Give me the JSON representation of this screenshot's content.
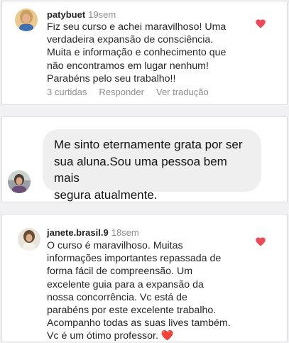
{
  "comments": [
    {
      "username": "patybuet",
      "time": "19sem",
      "text": "Fiz seu curso e achei maravilhoso! Uma\nverdadeira expansão de consciência.\nMuita e informação e conhecimento que\nnão encontramos em lugar nenhum!\nParabéns pelo seu trabalho!!",
      "likes": "3 curtidas",
      "reply": "Responder",
      "translate": "Ver tradução"
    },
    {
      "text": "Me sinto eternamente grata por ser\nsua aluna.Sou uma pessoa bem mais\nsegura atualmente."
    },
    {
      "username": "janete.brasil.9",
      "time": "18sem",
      "text": "O curso é maravilhoso. Muitas\ninformações importantes repassada de\nforma fácil de compreensão.  Um\nexcelente guia para a  expansão da\nnossa concorrência.  Vc está de\nparabéns por este excelente trabalho.\nAcompanho todas as suas lives também.\nVc é um ótimo professor.",
      "emoji": "❤️"
    }
  ],
  "colors": {
    "heart": "#ed4956",
    "muted": "#8e8e8e",
    "bubble": "#efeff0"
  }
}
